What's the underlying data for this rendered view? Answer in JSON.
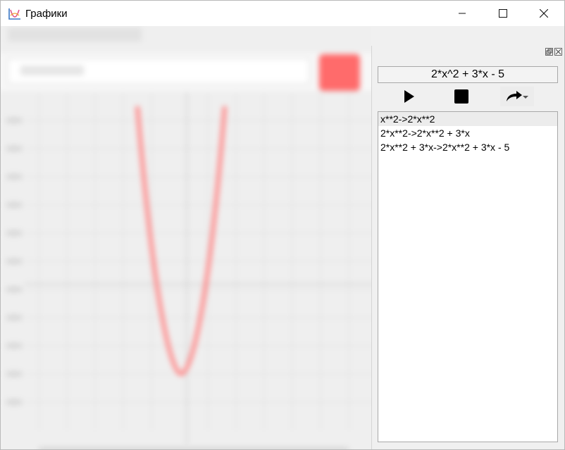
{
  "window": {
    "title": "Графики",
    "minimize_icon": "minimize-icon",
    "maximize_icon": "maximize-icon",
    "close_icon": "close-icon"
  },
  "dock": {
    "float_icon": "float-icon",
    "close_icon": "close-icon",
    "expression": "2*x^2 + 3*x - 5",
    "controls": {
      "play_icon": "play-icon",
      "stop_icon": "stop-icon",
      "share_icon": "share-arrow-icon"
    },
    "history": [
      "x**2->2*x**2",
      "2*x**2->2*x**2 + 3*x",
      "2*x**2 + 3*x->2*x**2 + 3*x - 5"
    ],
    "selected_index": 0
  },
  "colors": {
    "plot_curve": "#ff8080",
    "apply_button": "#ff6b6b",
    "panel_bg": "#f0f0f0"
  }
}
